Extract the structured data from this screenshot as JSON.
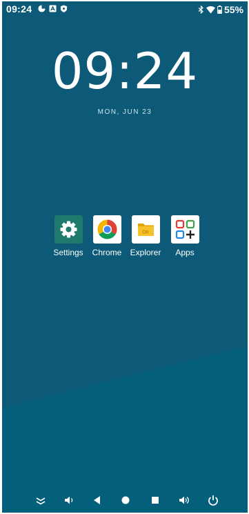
{
  "status_bar": {
    "time": "09:24",
    "left_icons": [
      "data-saver-icon",
      "notification-a-icon",
      "shield-icon"
    ],
    "right_icons": [
      "bluetooth-icon",
      "wifi-icon",
      "battery-icon"
    ],
    "battery": "55%"
  },
  "lock_clock": {
    "time": "09:24",
    "date": "MON, JUN 23"
  },
  "apps": [
    {
      "label": "Settings",
      "icon": "settings-icon"
    },
    {
      "label": "Chrome",
      "icon": "chrome-icon"
    },
    {
      "label": "Explorer",
      "icon": "explorer-icon"
    },
    {
      "label": "Apps",
      "icon": "apps-grid-icon"
    }
  ],
  "nav_bar": {
    "buttons": [
      "collapse-icon",
      "volume-down-icon",
      "back-icon",
      "home-icon",
      "recents-icon",
      "volume-up-icon",
      "power-icon"
    ]
  },
  "colors": {
    "wallpaper_upper": "#0c5a77",
    "wallpaper_lower": "#045f7a",
    "settings_bg": "#1f7a6d",
    "explorer_yellow": "#f6c22b"
  }
}
